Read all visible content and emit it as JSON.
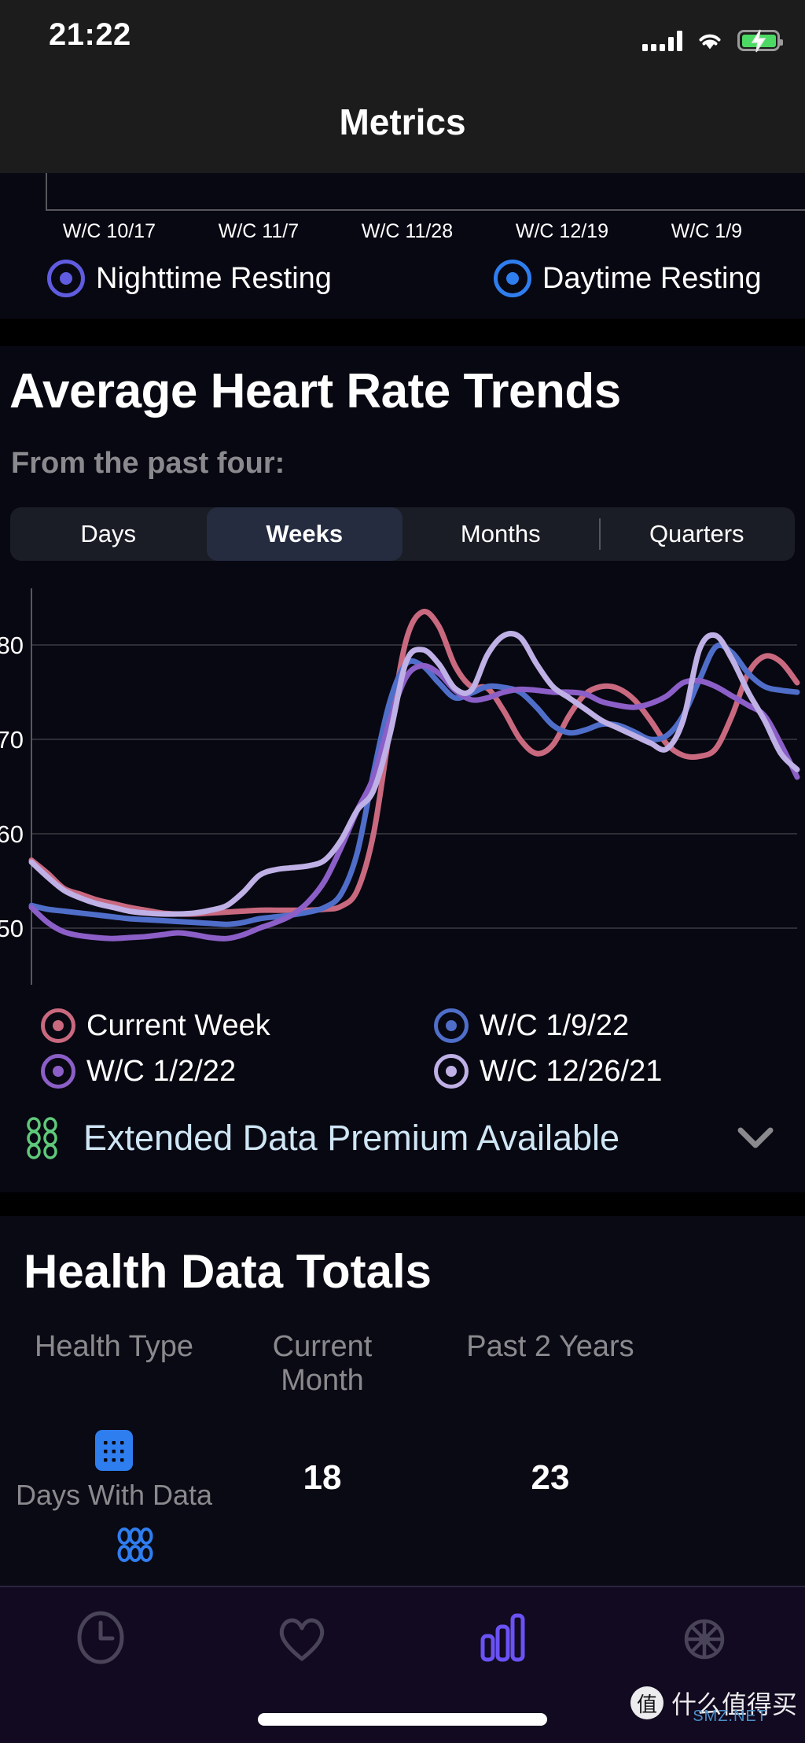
{
  "status_bar": {
    "time": "21:22",
    "signal_icon": "cellular-signal-icon",
    "wifi_icon": "wifi-icon",
    "battery_icon": "battery-charging-icon"
  },
  "nav": {
    "title": "Metrics"
  },
  "top_chart": {
    "x_labels": [
      "W/C 10/17",
      "W/C 11/7",
      "W/C 11/28",
      "W/C 12/19",
      "W/C 1/9"
    ],
    "legend": [
      {
        "label": "Nighttime Resting",
        "color": "#5f5ce0"
      },
      {
        "label": "Daytime Resting",
        "color": "#2f7ef0"
      }
    ]
  },
  "hr_section": {
    "title": "Average Heart Rate Trends",
    "subtitle": "From the past four:",
    "segments": [
      {
        "label": "Days",
        "selected": false
      },
      {
        "label": "Weeks",
        "selected": true
      },
      {
        "label": "Months",
        "selected": false
      },
      {
        "label": "Quarters",
        "selected": false
      }
    ],
    "legend": [
      {
        "label": "Current Week",
        "color": "#c9697f"
      },
      {
        "label": "W/C 1/9/22",
        "color": "#4f6ec9"
      },
      {
        "label": "W/C 1/2/22",
        "color": "#8b5fc7"
      },
      {
        "label": "W/C 12/26/21",
        "color": "#bfb0e6"
      }
    ],
    "premium": {
      "label": "Extended Data Premium Available",
      "icon": "circles-grid-icon",
      "icon_color": "#5fc97a",
      "chevron": "chevron-down-icon",
      "text_color": "#cfe6f5"
    }
  },
  "chart_data": {
    "type": "line",
    "title": "Average Heart Rate Trends",
    "xlabel": "",
    "ylabel": "",
    "ylim": [
      44,
      86
    ],
    "yticks": [
      50,
      60,
      70,
      80
    ],
    "grid": true,
    "legend_position": "bottom",
    "x": [
      0,
      1,
      2,
      3,
      4,
      5,
      6,
      7,
      8,
      9,
      10,
      11,
      12,
      13,
      14,
      15,
      16,
      17,
      18,
      19,
      20,
      21,
      22,
      23,
      24,
      25,
      26,
      27,
      28,
      29,
      30,
      31,
      32,
      33,
      34,
      35,
      36,
      37,
      38,
      39,
      40,
      41,
      42,
      43,
      44,
      45,
      46,
      47
    ],
    "series": [
      {
        "name": "Current Week",
        "color": "#c9697f",
        "values": [
          57.2,
          55.8,
          54.2,
          53.6,
          53.0,
          52.6,
          52.2,
          51.9,
          51.6,
          51.5,
          51.5,
          51.6,
          51.7,
          51.8,
          51.9,
          51.9,
          51.9,
          51.9,
          52.0,
          52.3,
          54.0,
          60.0,
          71.0,
          80.5,
          83.5,
          82.0,
          77.8,
          75.6,
          75.4,
          73.0,
          70.0,
          68.5,
          69.4,
          72.5,
          74.8,
          75.6,
          75.4,
          74.2,
          72.0,
          69.5,
          68.3,
          68.2,
          69.0,
          72.5,
          77.0,
          78.8,
          78.2,
          76.0
        ]
      },
      {
        "name": "W/C 1/9/22",
        "color": "#4f6ec9",
        "values": [
          52.4,
          52.0,
          51.8,
          51.6,
          51.4,
          51.2,
          51.0,
          50.9,
          50.8,
          50.7,
          50.6,
          50.5,
          50.4,
          50.6,
          51.0,
          51.2,
          51.4,
          51.7,
          52.2,
          53.6,
          58.0,
          66.5,
          74.0,
          78.0,
          77.8,
          76.0,
          74.4,
          74.9,
          75.6,
          75.5,
          75.0,
          73.4,
          71.5,
          70.7,
          71.0,
          71.6,
          71.5,
          70.8,
          70.0,
          70.4,
          72.5,
          76.3,
          79.8,
          79.2,
          77.0,
          75.6,
          75.2,
          75.0
        ]
      },
      {
        "name": "W/C 1/2/22",
        "color": "#8b5fc7",
        "values": [
          52.2,
          50.6,
          49.6,
          49.2,
          49.0,
          48.9,
          49.0,
          49.1,
          49.3,
          49.5,
          49.3,
          49.0,
          48.9,
          49.3,
          50.0,
          50.6,
          51.4,
          52.8,
          55.0,
          58.5,
          62.5,
          66.0,
          72.0,
          76.6,
          77.8,
          77.0,
          75.2,
          74.2,
          74.4,
          75.0,
          75.3,
          75.2,
          75.0,
          75.0,
          74.8,
          74.0,
          73.6,
          73.4,
          73.8,
          74.6,
          76.0,
          76.2,
          75.6,
          74.6,
          73.6,
          72.5,
          69.5,
          66.0
        ]
      },
      {
        "name": "W/C 12/26/21",
        "color": "#bfb0e6",
        "values": [
          57.0,
          55.4,
          54.0,
          53.2,
          52.6,
          52.2,
          51.8,
          51.6,
          51.5,
          51.5,
          51.6,
          51.9,
          52.4,
          53.8,
          55.6,
          56.2,
          56.4,
          56.6,
          57.2,
          59.3,
          62.5,
          64.6,
          70.5,
          78.2,
          79.5,
          78.0,
          75.4,
          75.2,
          79.0,
          81.0,
          80.8,
          78.0,
          75.6,
          74.4,
          73.2,
          72.0,
          71.2,
          70.4,
          69.6,
          69.0,
          72.0,
          79.5,
          81.0,
          78.5,
          75.0,
          72.0,
          68.5,
          66.8
        ]
      }
    ]
  },
  "health_totals": {
    "title": "Health Data Totals",
    "columns": [
      "Health Type",
      "Current Month",
      "Past 2 Years"
    ],
    "rows": [
      {
        "icon": "calendar-icon",
        "icon_color": "#2f7ef0",
        "label": "Days With Data",
        "current_month": "18",
        "past_2_years": "23"
      }
    ],
    "next_row_icon": "circles-grid-icon"
  },
  "tab_bar": {
    "items": [
      {
        "icon": "clock-icon",
        "active": false
      },
      {
        "icon": "heart-icon",
        "active": false
      },
      {
        "icon": "bar-chart-icon",
        "active": true
      },
      {
        "icon": "gear-icon",
        "active": false
      }
    ],
    "active_color": "#6a52f5",
    "inactive_color": "#4a4458"
  },
  "watermark": {
    "logo": "值",
    "text": "什么值得买",
    "sub": "SMZ.NET"
  }
}
